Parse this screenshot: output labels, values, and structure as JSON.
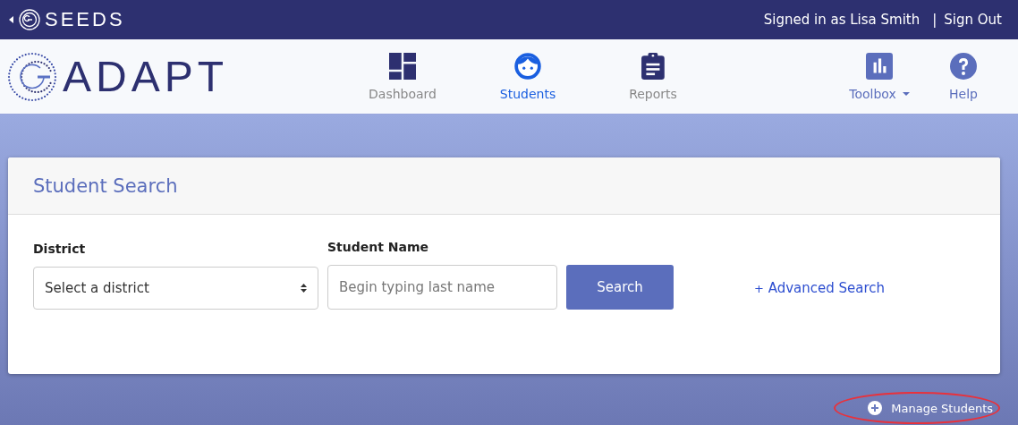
{
  "top_bar": {
    "brand": "SEEDS",
    "signed_in": "Signed in as Lisa Smith",
    "separator": "|",
    "sign_out": "Sign Out"
  },
  "header": {
    "logo": "ADAPT",
    "nav": [
      {
        "label": "Dashboard",
        "kind": "dashboard",
        "selected": false
      },
      {
        "label": "Students",
        "kind": "students",
        "selected": true
      },
      {
        "label": "Reports",
        "kind": "reports",
        "selected": false
      }
    ],
    "tools": [
      {
        "label": "Toolbox",
        "kind": "toolbox",
        "dropdown": true
      },
      {
        "label": "Help",
        "kind": "help",
        "dropdown": false
      }
    ]
  },
  "card": {
    "title": "Student Search",
    "district": {
      "label": "District",
      "value": "Select a district"
    },
    "student_name": {
      "label": "Student Name",
      "placeholder": "Begin typing last name"
    },
    "search_button": "Search",
    "advanced_icon": "+",
    "advanced": "Advanced Search"
  },
  "manage": {
    "label": "Manage Students",
    "highlighted": true
  }
}
